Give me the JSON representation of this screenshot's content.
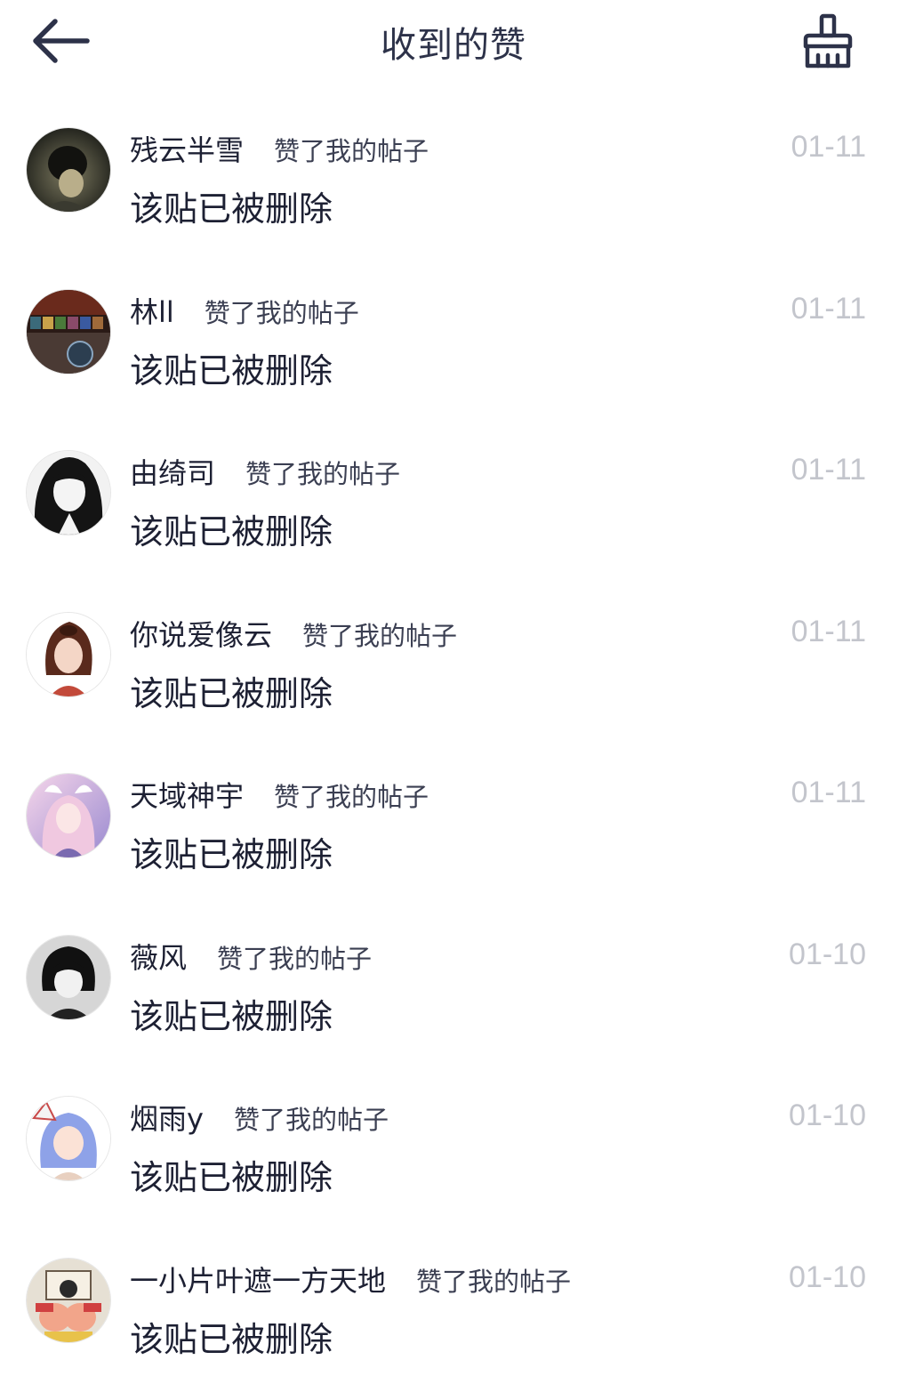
{
  "header": {
    "title": "收到的赞",
    "back_icon": "arrow-left-icon",
    "clear_icon": "broom-icon"
  },
  "items": [
    {
      "username": "残云半雪",
      "action": "赞了我的帖子",
      "date": "01-11",
      "content": "该贴已被删除"
    },
    {
      "username": "林ll",
      "action": "赞了我的帖子",
      "date": "01-11",
      "content": "该贴已被删除"
    },
    {
      "username": "由绮司",
      "action": "赞了我的帖子",
      "date": "01-11",
      "content": "该贴已被删除"
    },
    {
      "username": "你说爱像云",
      "action": "赞了我的帖子",
      "date": "01-11",
      "content": "该贴已被删除"
    },
    {
      "username": "天域神宇",
      "action": "赞了我的帖子",
      "date": "01-11",
      "content": "该贴已被删除"
    },
    {
      "username": "薇风",
      "action": "赞了我的帖子",
      "date": "01-10",
      "content": "该贴已被删除"
    },
    {
      "username": "烟雨y",
      "action": "赞了我的帖子",
      "date": "01-10",
      "content": "该贴已被删除"
    },
    {
      "username": "一小片叶遮一方天地",
      "action": "赞了我的帖子",
      "date": "01-10",
      "content": "该贴已被删除"
    }
  ],
  "colors": {
    "title": "#2d3249",
    "text": "#1d2033",
    "date": "#c3c5cc"
  }
}
